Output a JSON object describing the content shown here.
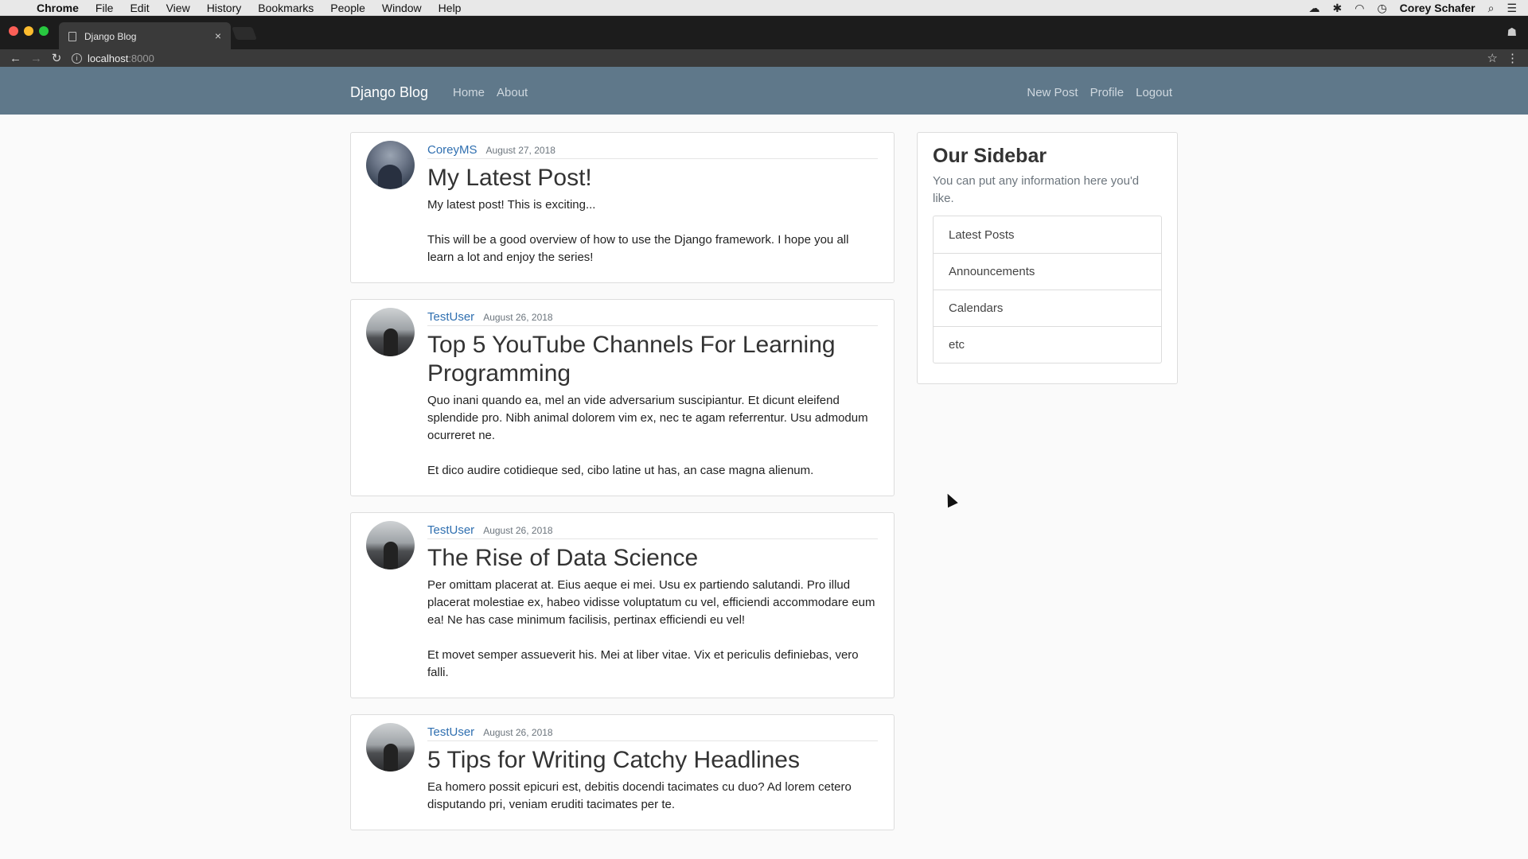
{
  "menubar": {
    "app": "Chrome",
    "items": [
      "File",
      "Edit",
      "View",
      "History",
      "Bookmarks",
      "People",
      "Window",
      "Help"
    ],
    "user": "Corey Schafer"
  },
  "browser": {
    "tab_title": "Django Blog",
    "url_host": "localhost",
    "url_port": ":8000"
  },
  "site": {
    "brand": "Django Blog",
    "nav_left": [
      "Home",
      "About"
    ],
    "nav_right": [
      "New Post",
      "Profile",
      "Logout"
    ]
  },
  "posts": [
    {
      "author": "CoreyMS",
      "date": "August 27, 2018",
      "title": "My Latest Post!",
      "content": "My latest post! This is exciting...\n\nThis will be a good overview of how to use the Django framework. I hope you all learn a lot and enjoy the series!"
    },
    {
      "author": "TestUser",
      "date": "August 26, 2018",
      "title": "Top 5 YouTube Channels For Learning Programming",
      "content": "Quo inani quando ea, mel an vide adversarium suscipiantur. Et dicunt eleifend splendide pro. Nibh animal dolorem vim ex, nec te agam referrentur. Usu admodum ocurreret ne.\n\nEt dico audire cotidieque sed, cibo latine ut has, an case magna alienum."
    },
    {
      "author": "TestUser",
      "date": "August 26, 2018",
      "title": "The Rise of Data Science",
      "content": "Per omittam placerat at. Eius aeque ei mei. Usu ex partiendo salutandi. Pro illud placerat molestiae ex, habeo vidisse voluptatum cu vel, efficiendi accommodare eum ea! Ne has case minimum facilisis, pertinax efficiendi eu vel!\n\nEt movet semper assueverit his. Mei at liber vitae. Vix et periculis definiebas, vero falli."
    },
    {
      "author": "TestUser",
      "date": "August 26, 2018",
      "title": "5 Tips for Writing Catchy Headlines",
      "content": "Ea homero possit epicuri est, debitis docendi tacimates cu duo? Ad lorem cetero disputando pri, veniam eruditi tacimates per te."
    }
  ],
  "sidebar": {
    "title": "Our Sidebar",
    "text": "You can put any information here you'd like.",
    "items": [
      "Latest Posts",
      "Announcements",
      "Calendars",
      "etc"
    ]
  }
}
